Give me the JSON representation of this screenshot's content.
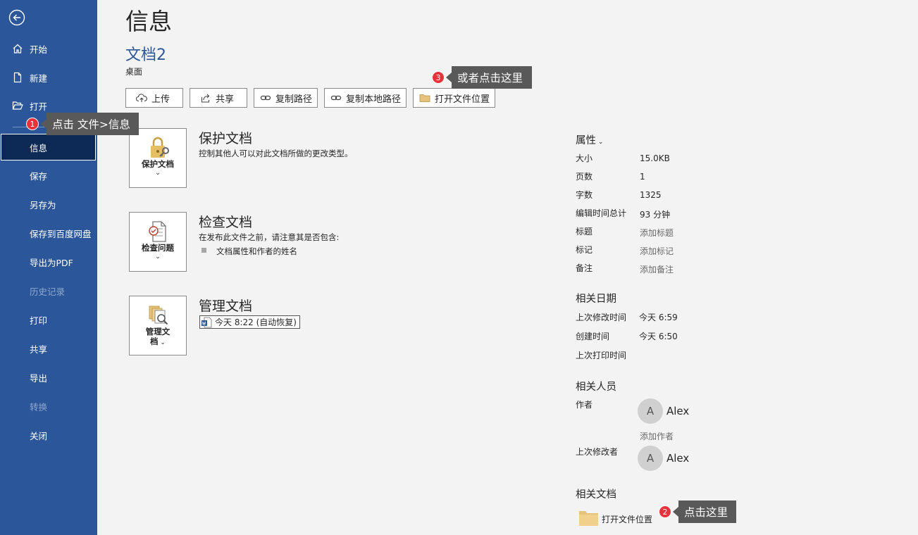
{
  "sidebar": {
    "back_icon": "back-arrow-icon",
    "items": [
      {
        "label": "开始",
        "icon": "home-icon"
      },
      {
        "label": "新建",
        "icon": "new-document-icon"
      },
      {
        "label": "打开",
        "icon": "open-folder-icon"
      },
      {
        "label": "信息"
      },
      {
        "label": "保存"
      },
      {
        "label": "另存为"
      },
      {
        "label": "保存到百度网盘"
      },
      {
        "label": "导出为PDF"
      },
      {
        "label": "历史记录"
      },
      {
        "label": "打印"
      },
      {
        "label": "共享"
      },
      {
        "label": "导出"
      },
      {
        "label": "转换"
      },
      {
        "label": "关闭"
      }
    ]
  },
  "header": {
    "title": "信息",
    "doc_name": "文档2",
    "doc_location": "桌面"
  },
  "toolbar": {
    "upload": "上传",
    "share": "共享",
    "copy_path": "复制路径",
    "copy_local_path": "复制本地路径",
    "open_location": "打开文件位置"
  },
  "sections": {
    "protect": {
      "button": "保护文档",
      "title": "保护文档",
      "desc": "控制其他人可以对此文档所做的更改类型。"
    },
    "inspect": {
      "button": "检查问题",
      "title": "检查文档",
      "desc": "在发布此文件之前，请注意其是否包含:",
      "bullet": "文档属性和作者的姓名"
    },
    "manage": {
      "button_line1": "管理文",
      "button_line2": "档",
      "title": "管理文档",
      "autosave": "今天 8:22 (自动恢复)"
    }
  },
  "properties": {
    "header": "属性",
    "size_label": "大小",
    "size": "15.0KB",
    "pages_label": "页数",
    "pages": "1",
    "words_label": "字数",
    "words": "1325",
    "edit_time_label": "编辑时间总计",
    "edit_time": "93 分钟",
    "title_label": "标题",
    "title_value": "添加标题",
    "tags_label": "标记",
    "tags_value": "添加标记",
    "comments_label": "备注",
    "comments_value": "添加备注"
  },
  "dates": {
    "header": "相关日期",
    "modified_label": "上次修改时间",
    "modified": "今天 6:59",
    "created_label": "创建时间",
    "created": "今天 6:50",
    "printed_label": "上次打印时间"
  },
  "people": {
    "header": "相关人员",
    "author_label": "作者",
    "author_initial": "A",
    "author": "Alex",
    "add_author": "添加作者",
    "last_modified_by_label": "上次修改者",
    "modifier_initial": "A",
    "modifier": "Alex"
  },
  "related_docs": {
    "header": "相关文档",
    "open_location": "打开文件位置"
  },
  "callouts": [
    {
      "number": "1",
      "text": "点击 文件>信息"
    },
    {
      "number": "2",
      "text": "点击这里"
    },
    {
      "number": "3",
      "text": "或者点击这里"
    }
  ],
  "colors": {
    "sidebar": "#2b579a",
    "active": "#0d2a57",
    "callout": "#595959",
    "badge": "#e8313a"
  }
}
